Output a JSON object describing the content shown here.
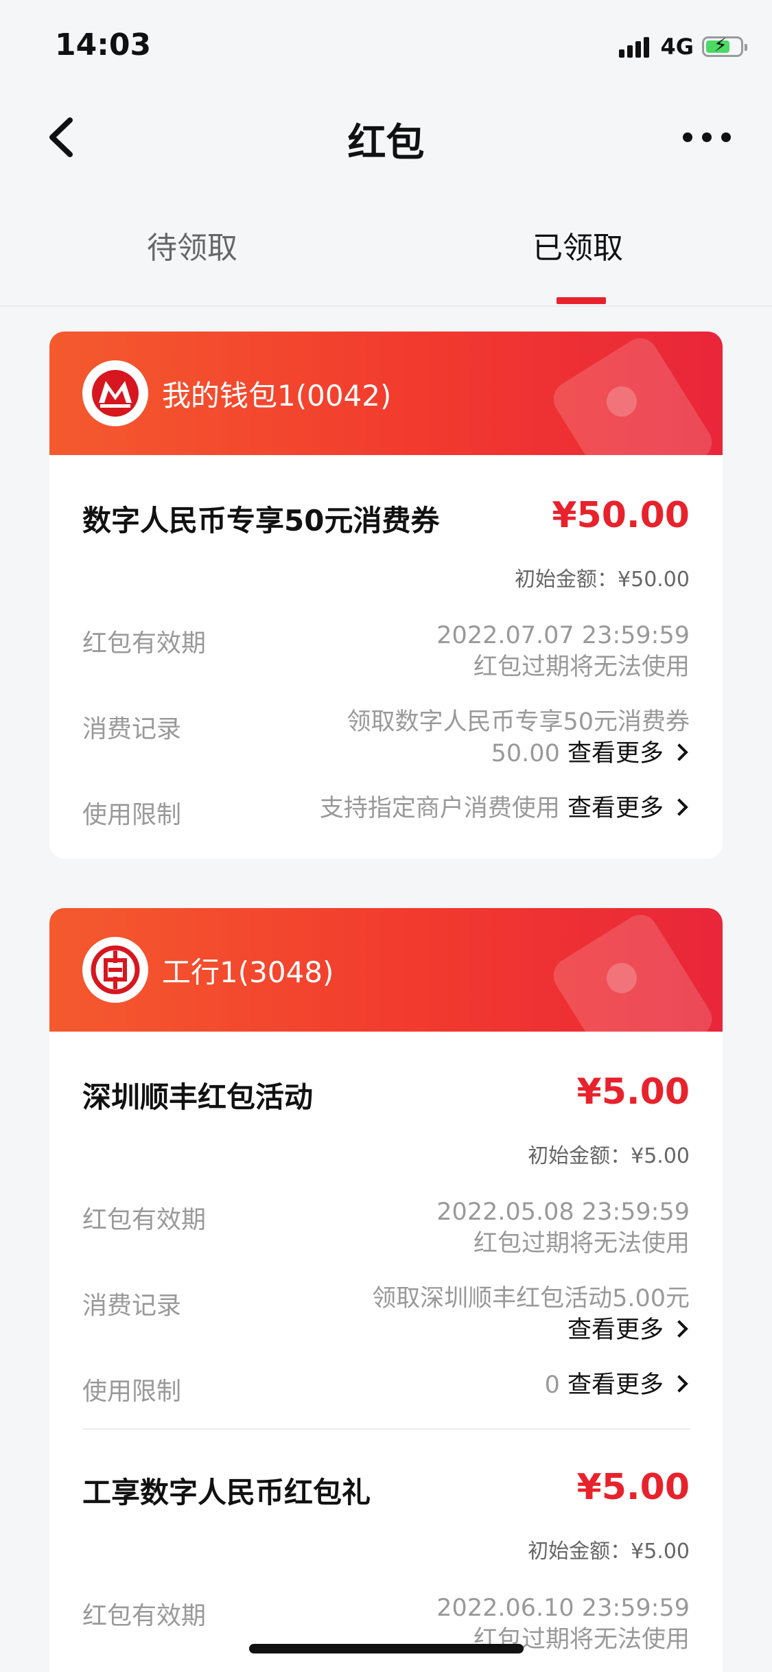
{
  "status_bar": {
    "time": "14:03",
    "network": "4G",
    "battery_level": 0.7,
    "signal_icon": "signal-icon",
    "battery_icon": "battery-charging-icon"
  },
  "nav": {
    "title": "红包",
    "back_icon": "chevron-left-icon",
    "more_icon": "more-dots-icon"
  },
  "tabs": [
    {
      "label": "待领取",
      "active": false
    },
    {
      "label": "已领取",
      "active": true
    }
  ],
  "colors": {
    "accent": "#e8222c",
    "header_gradient_start": "#f45a2e",
    "header_gradient_end": "#e9263a"
  },
  "cards": [
    {
      "wallet": "我的钱包1(0042)",
      "bank_logo": "cmb-bank-logo-icon",
      "items": [
        {
          "title": "数字人民币专享50元消费券",
          "amount": "¥50.00",
          "initial": "初始金额：¥50.00",
          "validity_label": "红包有效期",
          "validity_date": "2022.07.07 23:59:59",
          "validity_note": "红包过期将无法使用",
          "records_label": "消费记录",
          "records_line1": "领取数字人民币专享50元消费券",
          "records_line2": "50.00",
          "records_more": "查看更多",
          "limit_label": "使用限制",
          "limit_value": "支持指定商户消费使用",
          "limit_more": "查看更多"
        }
      ]
    },
    {
      "wallet": "工行1(3048)",
      "bank_logo": "icbc-bank-logo-icon",
      "items": [
        {
          "title": "深圳顺丰红包活动",
          "amount": "¥5.00",
          "initial": "初始金额：¥5.00",
          "validity_label": "红包有效期",
          "validity_date": "2022.05.08 23:59:59",
          "validity_note": "红包过期将无法使用",
          "records_label": "消费记录",
          "records_line1": "领取深圳顺丰红包活动5.00元",
          "records_more": "查看更多",
          "limit_label": "使用限制",
          "limit_value": "0",
          "limit_more": "查看更多"
        },
        {
          "title": "工享数字人民币红包礼",
          "amount": "¥5.00",
          "initial": "初始金额：¥5.00",
          "validity_label": "红包有效期",
          "validity_date": "2022.06.10 23:59:59",
          "validity_note": "红包过期将无法使用"
        }
      ]
    }
  ]
}
